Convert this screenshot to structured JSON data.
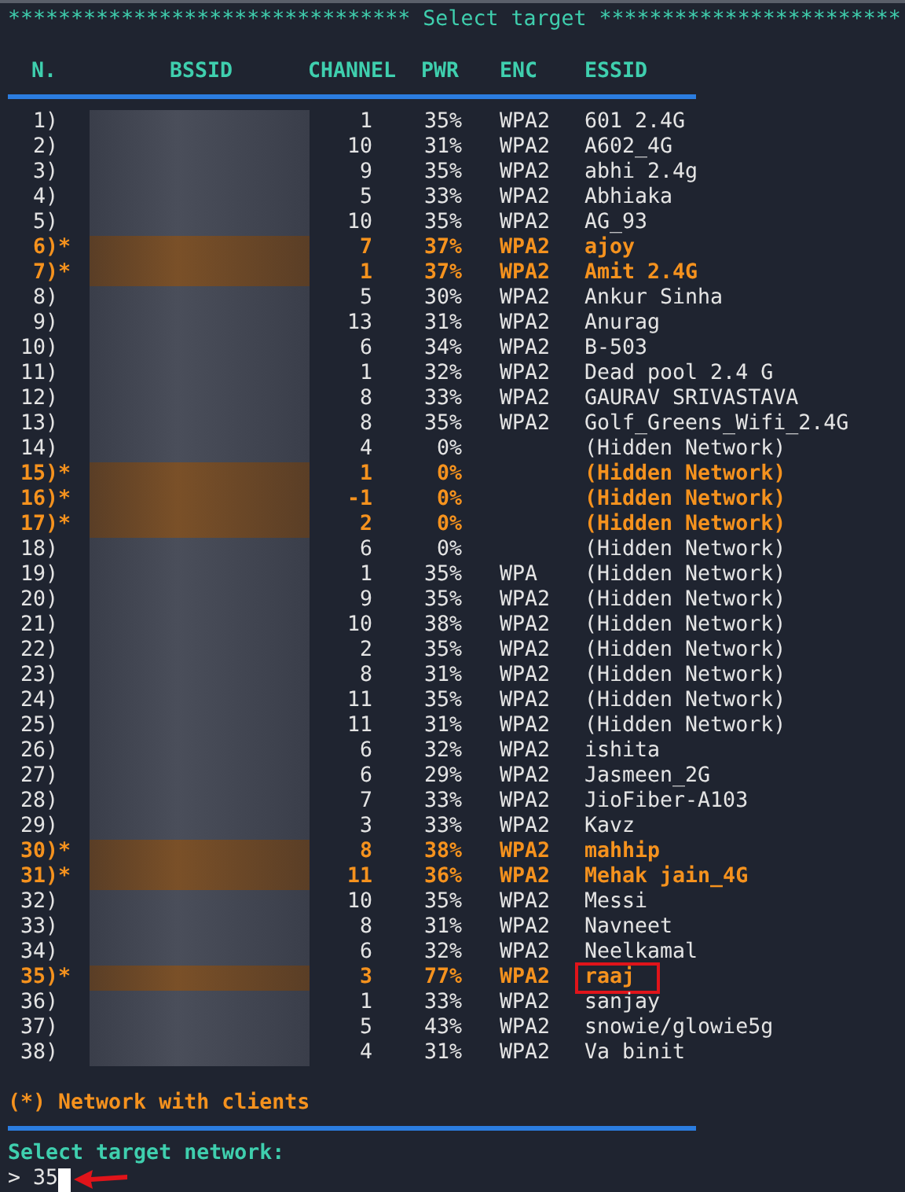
{
  "banner": "******************************** Select target ************************",
  "columns": [
    "N.",
    "BSSID",
    "CHANNEL",
    "PWR",
    "ENC",
    "ESSID"
  ],
  "rows": [
    {
      "num": "1)",
      "channel": "1",
      "pwr": "35%",
      "enc": "WPA2",
      "essid": "601 2.4G",
      "clients": false,
      "highlighted": false
    },
    {
      "num": "2)",
      "channel": "10",
      "pwr": "31%",
      "enc": "WPA2",
      "essid": "A602_4G",
      "clients": false,
      "highlighted": false
    },
    {
      "num": "3)",
      "channel": "9",
      "pwr": "35%",
      "enc": "WPA2",
      "essid": "abhi 2.4g",
      "clients": false,
      "highlighted": false
    },
    {
      "num": "4)",
      "channel": "5",
      "pwr": "33%",
      "enc": "WPA2",
      "essid": "Abhiaka",
      "clients": false,
      "highlighted": false
    },
    {
      "num": "5)",
      "channel": "10",
      "pwr": "35%",
      "enc": "WPA2",
      "essid": "AG_93",
      "clients": false,
      "highlighted": false
    },
    {
      "num": "6)",
      "marker": "*",
      "channel": "7",
      "pwr": "37%",
      "enc": "WPA2",
      "essid": "ajoy",
      "clients": true,
      "highlighted": false
    },
    {
      "num": "7)",
      "marker": "*",
      "channel": "1",
      "pwr": "37%",
      "enc": "WPA2",
      "essid": "Amit 2.4G",
      "clients": true,
      "highlighted": false
    },
    {
      "num": "8)",
      "channel": "5",
      "pwr": "30%",
      "enc": "WPA2",
      "essid": "Ankur Sinha",
      "clients": false,
      "highlighted": false
    },
    {
      "num": "9)",
      "channel": "13",
      "pwr": "31%",
      "enc": "WPA2",
      "essid": "Anurag",
      "clients": false,
      "highlighted": false
    },
    {
      "num": "10)",
      "channel": "6",
      "pwr": "34%",
      "enc": "WPA2",
      "essid": "B-503",
      "clients": false,
      "highlighted": false
    },
    {
      "num": "11)",
      "channel": "1",
      "pwr": "32%",
      "enc": "WPA2",
      "essid": "Dead pool 2.4 G",
      "clients": false,
      "highlighted": false
    },
    {
      "num": "12)",
      "channel": "8",
      "pwr": "33%",
      "enc": "WPA2",
      "essid": "GAURAV SRIVASTAVA",
      "clients": false,
      "highlighted": false
    },
    {
      "num": "13)",
      "channel": "8",
      "pwr": "35%",
      "enc": "WPA2",
      "essid": "Golf_Greens_Wifi_2.4G",
      "clients": false,
      "highlighted": false
    },
    {
      "num": "14)",
      "channel": "4",
      "pwr": "0%",
      "essid": "(Hidden Network)",
      "clients": false,
      "highlighted": false
    },
    {
      "num": "15)",
      "marker": "*",
      "channel": "1",
      "pwr": "0%",
      "essid": "(Hidden Network)",
      "clients": true,
      "highlighted": false
    },
    {
      "num": "16)",
      "marker": "*",
      "channel": "-1",
      "pwr": "0%",
      "essid": "(Hidden Network)",
      "clients": true,
      "highlighted": false
    },
    {
      "num": "17)",
      "marker": "*",
      "channel": "2",
      "pwr": "0%",
      "essid": "(Hidden Network)",
      "clients": true,
      "highlighted": false
    },
    {
      "num": "18)",
      "channel": "6",
      "pwr": "0%",
      "essid": "(Hidden Network)",
      "clients": false,
      "highlighted": false
    },
    {
      "num": "19)",
      "channel": "1",
      "pwr": "35%",
      "enc": "WPA",
      "essid": "(Hidden Network)",
      "clients": false,
      "highlighted": false
    },
    {
      "num": "20)",
      "channel": "9",
      "pwr": "35%",
      "enc": "WPA2",
      "essid": "(Hidden Network)",
      "clients": false,
      "highlighted": false
    },
    {
      "num": "21)",
      "channel": "10",
      "pwr": "38%",
      "enc": "WPA2",
      "essid": "(Hidden Network)",
      "clients": false,
      "highlighted": false
    },
    {
      "num": "22)",
      "channel": "2",
      "pwr": "35%",
      "enc": "WPA2",
      "essid": "(Hidden Network)",
      "clients": false,
      "highlighted": false
    },
    {
      "num": "23)",
      "channel": "8",
      "pwr": "31%",
      "enc": "WPA2",
      "essid": "(Hidden Network)",
      "clients": false,
      "highlighted": false
    },
    {
      "num": "24)",
      "channel": "11",
      "pwr": "35%",
      "enc": "WPA2",
      "essid": "(Hidden Network)",
      "clients": false,
      "highlighted": false
    },
    {
      "num": "25)",
      "channel": "11",
      "pwr": "31%",
      "enc": "WPA2",
      "essid": "(Hidden Network)",
      "clients": false,
      "highlighted": false
    },
    {
      "num": "26)",
      "channel": "6",
      "pwr": "32%",
      "enc": "WPA2",
      "essid": "ishita",
      "clients": false,
      "highlighted": false
    },
    {
      "num": "27)",
      "channel": "6",
      "pwr": "29%",
      "enc": "WPA2",
      "essid": "Jasmeen_2G",
      "clients": false,
      "highlighted": false
    },
    {
      "num": "28)",
      "channel": "7",
      "pwr": "33%",
      "enc": "WPA2",
      "essid": "JioFiber-A103",
      "clients": false,
      "highlighted": false
    },
    {
      "num": "29)",
      "channel": "3",
      "pwr": "33%",
      "enc": "WPA2",
      "essid": "Kavz",
      "clients": false,
      "highlighted": false
    },
    {
      "num": "30)",
      "marker": "*",
      "channel": "8",
      "pwr": "38%",
      "enc": "WPA2",
      "essid": "mahhip",
      "clients": true,
      "highlighted": false
    },
    {
      "num": "31)",
      "marker": "*",
      "channel": "11",
      "pwr": "36%",
      "enc": "WPA2",
      "essid": "Mehak jain_4G",
      "clients": true,
      "highlighted": false
    },
    {
      "num": "32)",
      "channel": "10",
      "pwr": "35%",
      "enc": "WPA2",
      "essid": "Messi",
      "clients": false,
      "highlighted": false
    },
    {
      "num": "33)",
      "channel": "8",
      "pwr": "31%",
      "enc": "WPA2",
      "essid": "Navneet",
      "clients": false,
      "highlighted": false
    },
    {
      "num": "34)",
      "channel": "6",
      "pwr": "32%",
      "enc": "WPA2",
      "essid": "Neelkamal",
      "clients": false,
      "highlighted": false
    },
    {
      "num": "35)",
      "marker": "*",
      "channel": "3",
      "pwr": "77%",
      "enc": "WPA2",
      "essid": "raaj",
      "clients": true,
      "highlighted": true
    },
    {
      "num": "36)",
      "channel": "1",
      "pwr": "33%",
      "enc": "WPA2",
      "essid": "sanjay",
      "clients": false,
      "highlighted": false
    },
    {
      "num": "37)",
      "channel": "5",
      "pwr": "43%",
      "enc": "WPA2",
      "essid": "snowie/glowie5g",
      "clients": false,
      "highlighted": false
    },
    {
      "num": "38)",
      "channel": "4",
      "pwr": "31%",
      "enc": "WPA2",
      "essid": "Va binit",
      "clients": false,
      "highlighted": false
    }
  ],
  "legend": "(*) Network with clients",
  "prompt": {
    "label": "Select target network:",
    "symbol": ">",
    "value": "35"
  }
}
